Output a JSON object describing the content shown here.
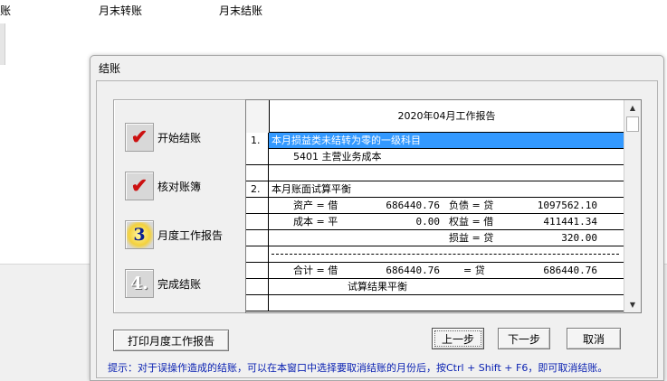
{
  "background": {
    "partial_label": "账",
    "tab_month_transfer": "月末转账",
    "tab_month_close": "月末结账"
  },
  "dialog": {
    "title": "结账"
  },
  "steps": [
    {
      "number": "1",
      "label": "开始结账",
      "icon": "check-icon"
    },
    {
      "number": "2",
      "label": "核对账簿",
      "icon": "check-icon"
    },
    {
      "number": "3",
      "label": "月度工作报告",
      "icon": "step-3-active-icon"
    },
    {
      "number": "4.",
      "label": "完成结账",
      "icon": "step-4-icon"
    }
  ],
  "report": {
    "title": "2020年04月工作报告",
    "section1": {
      "number": "1.",
      "heading": "本月损益类未结转为零的一级科目",
      "item": "5401 主营业务成本"
    },
    "section2": {
      "number": "2.",
      "heading": "本月账面试算平衡",
      "lines": [
        {
          "left_label": "资产 = 借",
          "left_value": "686440.76",
          "right_label": "负债 = 贷",
          "right_value": "1097562.10"
        },
        {
          "left_label": "成本 = 平",
          "left_value": "0.00",
          "right_label": "权益 = 借",
          "right_value": "411441.34"
        },
        {
          "left_label": "",
          "left_value": "",
          "right_label": "损益 = 贷",
          "right_value": "320.00"
        }
      ],
      "total": {
        "left_label": "合计 = 借",
        "left_value": "686440.76",
        "right_label": "= 贷",
        "right_value": "686440.76"
      },
      "result": "试算结果平衡"
    }
  },
  "buttons": {
    "print": "打印月度工作报告",
    "prev": "上一步",
    "next": "下一步",
    "cancel": "取消"
  },
  "hint": "提示：对于误操作造成的结账，可以在本窗口中选择要取消结账的月份后，按Ctrl + Shift + F6，即可取消结账。",
  "colors": {
    "selection": "#3399ff",
    "hint_text": "#0b22b2",
    "check_mark": "#cc1111"
  }
}
